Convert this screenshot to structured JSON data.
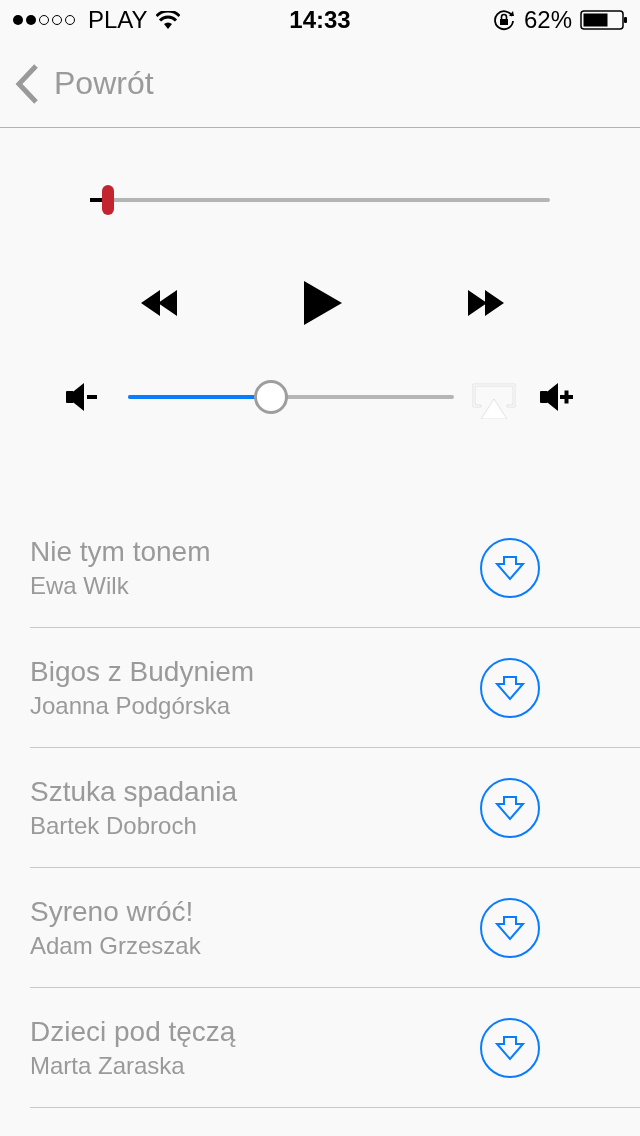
{
  "status_bar": {
    "carrier": "PLAY",
    "time": "14:33",
    "battery": "62%"
  },
  "nav": {
    "back": "Powrót"
  },
  "player": {
    "progress": {
      "level": 0.04
    },
    "volume": {
      "level": 0.44
    }
  },
  "tracks": [
    {
      "title": "Nie tym tonem",
      "author": "Ewa Wilk"
    },
    {
      "title": "Bigos z Budyniem",
      "author": "Joanna Podgórska"
    },
    {
      "title": "Sztuka spadania",
      "author": "Bartek Dobroch"
    },
    {
      "title": "Syreno wróć!",
      "author": "Adam Grzeszak"
    },
    {
      "title": "Dzieci pod tęczą",
      "author": "Marta Zaraska"
    }
  ]
}
